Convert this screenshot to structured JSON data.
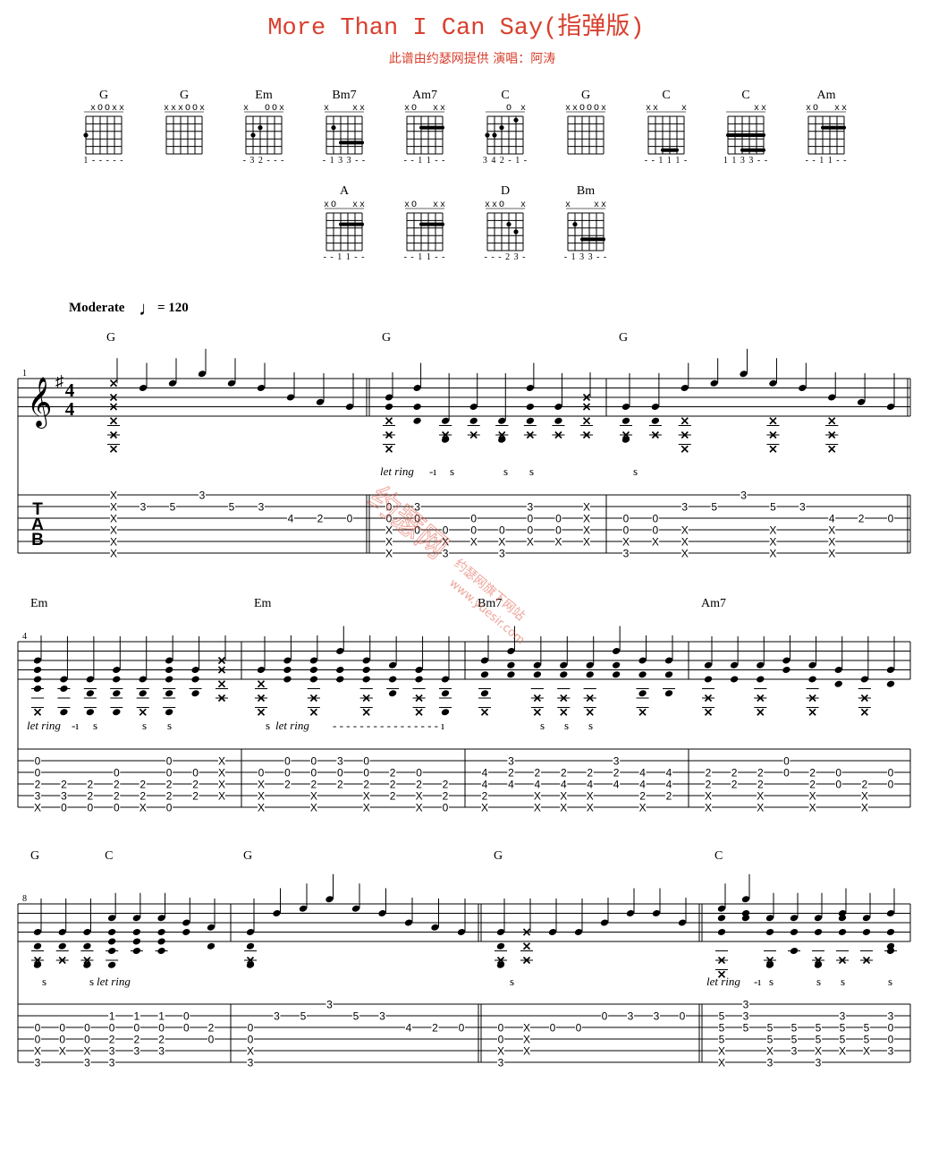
{
  "header": {
    "title": "More Than I Can Say(指弹版)",
    "subtitle": "此谱由约瑟网提供   演唱：阿涛"
  },
  "colors": {
    "title": "#d8402e",
    "ink": "#000000",
    "watermark": "#e05a48"
  },
  "chord_diagrams": [
    {
      "name": "G",
      "markers": " xOOxx",
      "dots": [
        [
          0,
          3
        ]
      ],
      "barres": [],
      "fingering": "1 - - - - -"
    },
    {
      "name": "G",
      "markers": "xxxOOx",
      "dots": [],
      "barres": [],
      "fingering": ""
    },
    {
      "name": "Em",
      "markers": "x  OOx",
      "dots": [
        [
          1,
          3
        ],
        [
          2,
          2
        ]
      ],
      "barres": [],
      "fingering": "- 3 2 - - -"
    },
    {
      "name": "Bm7",
      "markers": "x   xx",
      "dots": [
        [
          1,
          2
        ]
      ],
      "barres": [
        [
          2,
          5,
          4
        ]
      ],
      "fingering": "- 1 3 3 - -"
    },
    {
      "name": "Am7",
      "markers": "xO  xx",
      "dots": [],
      "barres": [
        [
          2,
          5,
          2
        ]
      ],
      "fingering": "- - 1 1 - -"
    },
    {
      "name": "C",
      "markers": "   O x",
      "dots": [
        [
          0,
          3
        ],
        [
          1,
          3
        ],
        [
          2,
          2
        ],
        [
          4,
          1
        ]
      ],
      "barres": [],
      "fingering": "3 4 2 - 1 -"
    },
    {
      "name": "G",
      "markers": "xxOOOx",
      "dots": [],
      "barres": [],
      "fingering": ""
    },
    {
      "name": "C",
      "markers": "xx   x",
      "dots": [],
      "barres": [
        [
          2,
          4,
          5
        ]
      ],
      "fingering": "- - 1 1 1 -"
    },
    {
      "name": "C",
      "markers": "    xx",
      "dots": [],
      "barres": [
        [
          0,
          5,
          3
        ],
        [
          2,
          5,
          5
        ]
      ],
      "fingering": "1 1 3 3 - -"
    },
    {
      "name": "Am",
      "markers": "xO  xx",
      "dots": [],
      "barres": [
        [
          2,
          5,
          2
        ]
      ],
      "fingering": "- - 1 1 - -"
    },
    {
      "name": "A",
      "markers": "xO  xx",
      "dots": [],
      "barres": [
        [
          2,
          5,
          2
        ]
      ],
      "fingering": "- - 1 1 - -"
    },
    {
      "name": "",
      "markers": "xO  xx",
      "dots": [],
      "barres": [
        [
          2,
          5,
          2
        ]
      ],
      "fingering": "- - 1 1 - -"
    },
    {
      "name": "D",
      "markers": "xxO  x",
      "dots": [
        [
          3,
          2
        ],
        [
          4,
          3
        ]
      ],
      "barres": [],
      "fingering": "- - - 2 3 -"
    },
    {
      "name": "Bm",
      "markers": "x   xx",
      "dots": [
        [
          1,
          2
        ]
      ],
      "barres": [
        [
          2,
          5,
          4
        ]
      ],
      "fingering": "- 1 3 3 - -"
    }
  ],
  "tempo": {
    "label": "Moderate",
    "note": "♩",
    "value": "= 120"
  },
  "time_signature": {
    "top": "4",
    "bottom": "4"
  },
  "key_signature": "G major (F#)",
  "tab_label": [
    "T",
    "A",
    "B"
  ],
  "watermark": {
    "text1": "约瑟网",
    "text2": "约瑟网旗下网站",
    "url": "www.yuesir.com"
  },
  "systems": [
    {
      "measure_number": "1",
      "annotations": [
        {
          "text": "let ring",
          "italic": true
        },
        {
          "text": "-ı",
          "italic": false
        },
        {
          "text": "s"
        },
        {
          "text": "s"
        },
        {
          "text": "s"
        },
        {
          "text": "s"
        }
      ],
      "measures": [
        {
          "chords": [
            "G"
          ],
          "columns": [
            [
              "X",
              "X",
              "X",
              "X",
              "X",
              "X"
            ],
            [
              "",
              "3",
              "",
              "",
              "",
              ""
            ],
            [
              "",
              "5",
              "",
              "",
              "",
              ""
            ],
            [
              "3",
              "",
              "",
              "",
              "",
              ""
            ],
            [
              "",
              "5",
              "",
              "",
              "",
              ""
            ],
            [
              "",
              "3",
              "",
              "",
              "",
              ""
            ],
            [
              "",
              "",
              "4",
              "",
              "",
              ""
            ],
            [
              "",
              "",
              "2",
              "",
              "",
              ""
            ],
            [
              "",
              "",
              "0",
              "",
              "",
              ""
            ]
          ]
        },
        {
          "chords": [
            "G"
          ],
          "columns": [
            [
              "",
              "0",
              "0",
              "X",
              "X",
              "X"
            ],
            [
              "",
              "3",
              "0",
              "0",
              "",
              ""
            ],
            [
              "",
              "",
              "",
              "0",
              "X",
              "3"
            ],
            [
              "",
              "",
              "0",
              "0",
              "X",
              ""
            ],
            [
              "",
              "",
              "",
              "0",
              "X",
              "3"
            ],
            [
              "",
              "3",
              "0",
              "0",
              "X",
              ""
            ],
            [
              "",
              "",
              "0",
              "0",
              "X",
              ""
            ],
            [
              "",
              "X",
              "X",
              "X",
              "X",
              ""
            ]
          ]
        },
        {
          "chords": [
            "G"
          ],
          "columns": [
            [
              "",
              "",
              "0",
              "0",
              "X",
              "3"
            ],
            [
              "",
              "",
              "0",
              "0",
              "X",
              ""
            ],
            [
              "",
              "3",
              "",
              "X",
              "X",
              "X"
            ],
            [
              "",
              "5",
              "",
              "",
              "",
              ""
            ],
            [
              "3",
              "",
              "",
              "",
              "",
              ""
            ],
            [
              "",
              "5",
              "",
              "X",
              "X",
              "X"
            ],
            [
              "",
              "3",
              "",
              "",
              "",
              ""
            ],
            [
              "",
              "",
              "4",
              "X",
              "X",
              "X"
            ],
            [
              "",
              "",
              "2",
              "",
              "",
              ""
            ],
            [
              "",
              "",
              "0",
              "",
              "",
              ""
            ]
          ]
        }
      ]
    },
    {
      "measure_number": "4",
      "annotations": [
        {
          "text": "let ring",
          "italic": true
        },
        {
          "text": "-ı",
          "italic": false
        },
        {
          "text": "s"
        },
        {
          "text": "s"
        },
        {
          "text": "s"
        },
        {
          "text": "s"
        },
        {
          "text": "let ring",
          "italic": true
        },
        {
          "text": "- - - - - - - - - - - - - - - - ı",
          "italic": false
        },
        {
          "text": "s"
        },
        {
          "text": "s"
        },
        {
          "text": "s"
        }
      ],
      "measures": [
        {
          "chords": [
            "Em"
          ],
          "columns": [
            [
              "",
              "0",
              "0",
              "2",
              "3",
              "X"
            ],
            [
              "",
              "",
              "",
              "2",
              "3",
              "0"
            ],
            [
              "",
              "",
              "",
              "2",
              "2",
              "0"
            ],
            [
              "",
              "",
              "0",
              "2",
              "2",
              "0"
            ],
            [
              "",
              "",
              "",
              "2",
              "2",
              "X"
            ],
            [
              "",
              "0",
              "0",
              "2",
              "2",
              "0"
            ],
            [
              "",
              "",
              "0",
              "2",
              "2",
              ""
            ],
            [
              "",
              "X",
              "X",
              "X",
              "X",
              ""
            ]
          ]
        },
        {
          "chords": [
            "Em"
          ],
          "columns": [
            [
              "",
              "",
              "0",
              "X",
              "X",
              "X"
            ],
            [
              "",
              "0",
              "0",
              "2",
              "",
              ""
            ],
            [
              "",
              "0",
              "0",
              "2",
              "X",
              "X"
            ],
            [
              "",
              "3",
              "0",
              "2",
              "",
              ""
            ],
            [
              "",
              "0",
              "0",
              "2",
              "X",
              "X"
            ],
            [
              "",
              "",
              "2",
              "2",
              "2",
              ""
            ],
            [
              "",
              "",
              "0",
              "2",
              "X",
              "X"
            ],
            [
              "",
              "",
              "",
              "2",
              "2",
              "0"
            ]
          ]
        },
        {
          "chords": [
            "Bm7"
          ],
          "columns": [
            [
              "",
              "",
              "4",
              "4",
              "2",
              "X"
            ],
            [
              "",
              "3",
              "2",
              "4",
              "",
              ""
            ],
            [
              "",
              "",
              "2",
              "4",
              "X",
              "X"
            ],
            [
              "",
              "",
              "2",
              "4",
              "X",
              "X"
            ],
            [
              "",
              "",
              "2",
              "4",
              "X",
              "X"
            ],
            [
              "",
              "3",
              "2",
              "4",
              "",
              ""
            ],
            [
              "",
              "",
              "4",
              "4",
              "2",
              "X"
            ],
            [
              "",
              "",
              "4",
              "4",
              "2",
              ""
            ]
          ]
        },
        {
          "chords": [
            "Am7"
          ],
          "columns": [
            [
              "",
              "",
              "2",
              "2",
              "X",
              "X"
            ],
            [
              "",
              "",
              "2",
              "2",
              "",
              ""
            ],
            [
              "",
              "",
              "2",
              "2",
              "X",
              "X"
            ],
            [
              "",
              "0",
              "0",
              "",
              "",
              ""
            ],
            [
              "",
              "",
              "2",
              "2",
              "X",
              "X"
            ],
            [
              "",
              "",
              "0",
              "0",
              "",
              ""
            ],
            [
              "",
              "",
              "",
              "2",
              "X",
              "X"
            ],
            [
              "",
              "",
              "0",
              "0",
              "",
              ""
            ]
          ]
        }
      ]
    },
    {
      "measure_number": "8",
      "annotations": [
        {
          "text": "s"
        },
        {
          "text": "s"
        },
        {
          "text": "let ring",
          "italic": true
        },
        {
          "text": "s"
        },
        {
          "text": "let ring",
          "italic": true
        },
        {
          "text": "-ı",
          "italic": false
        },
        {
          "text": "s"
        },
        {
          "text": "s"
        },
        {
          "text": "s"
        },
        {
          "text": "s"
        }
      ],
      "measures": [
        {
          "chords": [
            "G",
            "C"
          ],
          "columns": [
            [
              "",
              "",
              "0",
              "0",
              "X",
              "3"
            ],
            [
              "",
              "",
              "0",
              "0",
              "X",
              ""
            ],
            [
              "",
              "",
              "0",
              "0",
              "X",
              "3"
            ],
            [
              "",
              "1",
              "0",
              "2",
              "3",
              "3"
            ],
            [
              "",
              "1",
              "0",
              "2",
              "3",
              ""
            ],
            [
              "",
              "1",
              "0",
              "2",
              "3",
              ""
            ],
            [
              "",
              "0",
              "0",
              "",
              "",
              ""
            ],
            [
              "",
              "",
              "2",
              "0",
              "",
              ""
            ]
          ]
        },
        {
          "chords": [
            "G"
          ],
          "columns": [
            [
              "",
              "",
              "0",
              "0",
              "X",
              "3"
            ],
            [
              "",
              "3",
              "",
              "",
              "",
              ""
            ],
            [
              "",
              "5",
              "",
              "",
              "",
              ""
            ],
            [
              "3",
              "",
              "",
              "",
              "",
              ""
            ],
            [
              "",
              "5",
              "",
              "",
              "",
              ""
            ],
            [
              "",
              "3",
              "",
              "",
              "",
              ""
            ],
            [
              "",
              "",
              "4",
              "",
              "",
              ""
            ],
            [
              "",
              "",
              "2",
              "",
              "",
              ""
            ],
            [
              "",
              "",
              "0",
              "",
              "",
              ""
            ]
          ]
        },
        {
          "chords": [
            "G"
          ],
          "columns": [
            [
              "",
              "",
              "0",
              "0",
              "X",
              "3"
            ],
            [
              "",
              "",
              "X",
              "X",
              "X",
              ""
            ],
            [
              "",
              "",
              "0",
              "",
              "",
              ""
            ],
            [
              "",
              "",
              "0",
              "",
              "",
              ""
            ],
            [
              "",
              "0",
              "",
              "",
              "",
              ""
            ],
            [
              "",
              "3",
              "",
              "",
              "",
              ""
            ],
            [
              "",
              "3",
              "",
              "",
              "",
              ""
            ],
            [
              "",
              "0",
              "",
              "",
              "",
              ""
            ]
          ]
        },
        {
          "chords": [
            "C"
          ],
          "columns": [
            [
              "",
              "5",
              "5",
              "5",
              "X",
              "X"
            ],
            [
              "3",
              "3",
              "5",
              "",
              "",
              ""
            ],
            [
              "",
              "",
              "5",
              "5",
              "X",
              "3"
            ],
            [
              "",
              "",
              "5",
              "5",
              "3",
              ""
            ],
            [
              "",
              "",
              "5",
              "5",
              "X",
              "3"
            ],
            [
              "",
              "3",
              "5",
              "5",
              "X",
              ""
            ],
            [
              "",
              "",
              "5",
              "5",
              "X",
              ""
            ],
            [
              "",
              "3",
              "0",
              "0",
              "3",
              ""
            ]
          ]
        }
      ]
    }
  ]
}
